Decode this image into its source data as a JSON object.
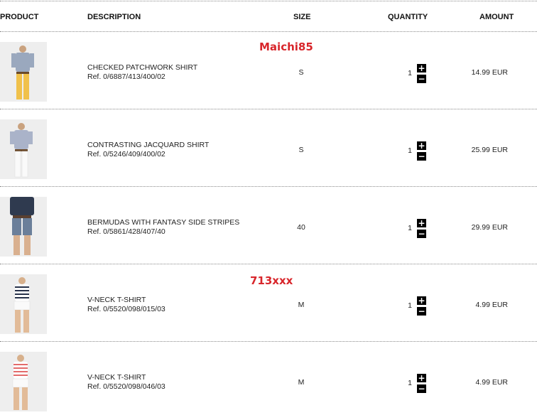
{
  "columns": {
    "product": "PRODUCT",
    "description": "DESCRIPTION",
    "size": "SIZE",
    "quantity": "QUANTITY",
    "amount": "AMOUNT"
  },
  "watermarks": [
    "Maichi85",
    "713xxx"
  ],
  "buttons": {
    "plus": "+",
    "minus": "−"
  },
  "items": [
    {
      "name": "CHECKED PATCHWORK SHIRT",
      "ref": "Ref. 0/6887/413/400/02",
      "size": "S",
      "quantity": "1",
      "amount": "14.99 EUR",
      "image": "man-yellow-trousers-photo"
    },
    {
      "name": "CONTRASTING JACQUARD SHIRT",
      "ref": "Ref. 0/5246/409/400/02",
      "size": "S",
      "quantity": "1",
      "amount": "25.99 EUR",
      "image": "man-white-trousers-photo"
    },
    {
      "name": "BERMUDAS WITH FANTASY SIDE STRIPES",
      "ref": "Ref. 0/5861/428/407/40",
      "size": "40",
      "quantity": "1",
      "amount": "29.99 EUR",
      "image": "man-denim-bermudas-photo"
    },
    {
      "name": "V-NECK T-SHIRT",
      "ref": "Ref. 0/5520/098/015/03",
      "size": "M",
      "quantity": "1",
      "amount": "4.99 EUR",
      "image": "woman-navy-striped-tee-photo"
    },
    {
      "name": "V-NECK T-SHIRT",
      "ref": "Ref. 0/5520/098/046/03",
      "size": "M",
      "quantity": "1",
      "amount": "4.99 EUR",
      "image": "woman-red-striped-tee-photo"
    }
  ]
}
